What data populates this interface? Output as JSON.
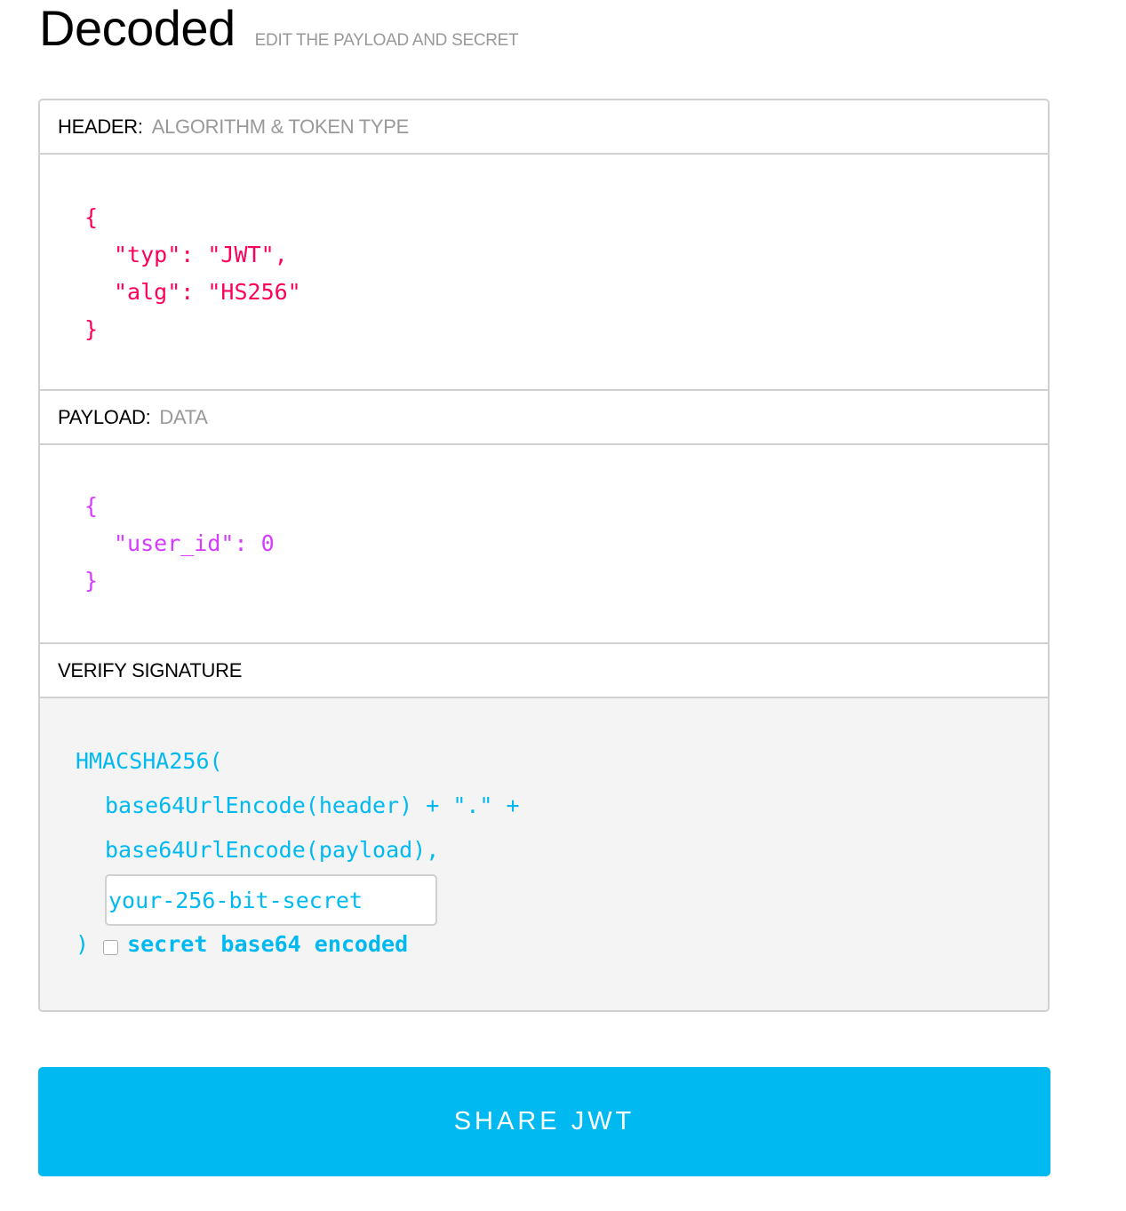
{
  "title": "Decoded",
  "subtitle": "EDIT THE PAYLOAD AND SECRET",
  "header_section": {
    "label": "HEADER:",
    "sublabel": "ALGORITHM & TOKEN TYPE",
    "lines": [
      "{",
      "\"typ\": \"JWT\",",
      "\"alg\": \"HS256\"",
      "}"
    ]
  },
  "payload_section": {
    "label": "PAYLOAD:",
    "sublabel": "DATA",
    "lines": [
      "{",
      "\"user_id\": 0",
      "}"
    ]
  },
  "signature_section": {
    "label": "VERIFY SIGNATURE",
    "fn_open": "HMACSHA256(",
    "line1": "base64UrlEncode(header) + \".\" +",
    "line2": "base64UrlEncode(payload),",
    "secret_value": "your-256-bit-secret",
    "fn_close": ")",
    "checkbox_label": "secret base64 encoded",
    "checkbox_checked": false
  },
  "share_button": "SHARE JWT",
  "colors": {
    "header_json": "#fb015b",
    "payload_json": "#d63aff",
    "signature": "#00b9f1",
    "share_button": "#00b9f1"
  }
}
